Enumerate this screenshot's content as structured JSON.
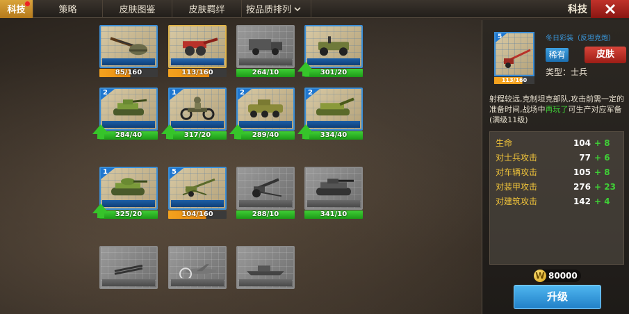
{
  "tabs": [
    {
      "label": "科技",
      "active": true,
      "has_alert": true
    },
    {
      "label": "策略",
      "active": false
    },
    {
      "label": "皮肤图鉴",
      "active": false
    },
    {
      "label": "皮肤羁绊",
      "active": false
    }
  ],
  "sort": {
    "label": "按品质排列"
  },
  "header": {
    "title": "科技",
    "close_icon": "close-icon"
  },
  "units": [
    {
      "name": "rifleman",
      "level": null,
      "progress": "85/160",
      "bar": "orange",
      "fill": 0.53,
      "style": "normal",
      "upgradable": false
    },
    {
      "name": "field-gun",
      "level": null,
      "progress": "113/160",
      "bar": "orange",
      "fill": 0.71,
      "style": "gold",
      "upgradable": false
    },
    {
      "name": "supply-truck",
      "level": null,
      "progress": "264/10",
      "bar": "green",
      "style": "grey",
      "upgradable": false
    },
    {
      "name": "jeep",
      "level": null,
      "progress": "301/20",
      "bar": "green",
      "style": "normal",
      "upgradable": true
    },
    {
      "name": "light-tank",
      "level": "2",
      "progress": "284/40",
      "bar": "green",
      "style": "normal",
      "upgradable": true
    },
    {
      "name": "motorcycle",
      "level": "1",
      "progress": "317/20",
      "bar": "green",
      "style": "normal",
      "upgradable": true
    },
    {
      "name": "armored-car",
      "level": "2",
      "progress": "289/40",
      "bar": "green",
      "style": "normal",
      "upgradable": true
    },
    {
      "name": "self-propelled-gun",
      "level": "2",
      "progress": "334/40",
      "bar": "green",
      "style": "normal",
      "upgradable": true
    },
    {
      "name": "medium-tank",
      "level": "1",
      "progress": "325/20",
      "bar": "green",
      "style": "normal",
      "upgradable": true
    },
    {
      "name": "anti-tank-gun",
      "level": "5",
      "progress": "104/160",
      "bar": "orange",
      "fill": 0.65,
      "style": "normal",
      "upgradable": false
    },
    {
      "name": "howitzer",
      "level": null,
      "progress": "288/10",
      "bar": "green",
      "style": "grey",
      "upgradable": false
    },
    {
      "name": "heavy-tank",
      "level": null,
      "progress": "341/10",
      "bar": "green",
      "style": "grey",
      "upgradable": false
    },
    {
      "name": "rocket-launcher",
      "level": null,
      "progress": null,
      "style": "grey"
    },
    {
      "name": "fighter-plane",
      "level": null,
      "progress": null,
      "style": "grey"
    },
    {
      "name": "warship",
      "level": null,
      "progress": null,
      "style": "grey"
    }
  ],
  "detail": {
    "level": "5",
    "progress": "113/160",
    "skin_name": "冬日彩装（反坦克炮）",
    "rarity": "稀有",
    "skin_button": "皮肤",
    "type": "类型：士兵",
    "desc_before": "射程较远,克制坦克部队,攻击前需一定的准备时间,战场中",
    "desc_highlight": "再玩了",
    "desc_after": "可生产对应军备(满级11级)",
    "stats": [
      {
        "label": "生命",
        "value": "104",
        "bonus": "+ 8"
      },
      {
        "label": "对士兵攻击",
        "value": "77",
        "bonus": "+ 6"
      },
      {
        "label": "对车辆攻击",
        "value": "105",
        "bonus": "+ 8"
      },
      {
        "label": "对装甲攻击",
        "value": "276",
        "bonus": "+ 23"
      },
      {
        "label": "对建筑攻击",
        "value": "142",
        "bonus": "+ 4"
      }
    ],
    "cost": "80000",
    "coin_symbol": "W",
    "upgrade_label": "升级"
  },
  "colors": {
    "accent": "#d9a43a",
    "rare_blue": "#3b8ed6",
    "bonus_green": "#3fcf36",
    "stat_gold": "#f0c33a",
    "close_red": "#c0322a"
  }
}
